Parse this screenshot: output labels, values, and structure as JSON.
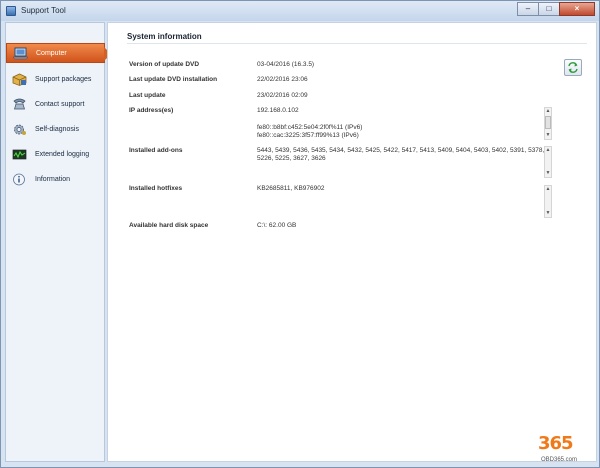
{
  "window": {
    "title": "Support Tool",
    "minimize": "–",
    "maximize": "□",
    "close": "×"
  },
  "sidebar": {
    "items": [
      {
        "label": "Computer",
        "icon": "laptop-icon",
        "active": true
      },
      {
        "label": "Support packages",
        "icon": "package-icon"
      },
      {
        "label": "Contact support",
        "icon": "phone-icon"
      },
      {
        "label": "Self-diagnosis",
        "icon": "gear-icon"
      },
      {
        "label": "Extended logging",
        "icon": "log-icon"
      },
      {
        "label": "Information",
        "icon": "info-icon"
      }
    ]
  },
  "main": {
    "heading": "System information",
    "rows": [
      {
        "label": "Version of update DVD",
        "value": "03-04/2016 (16.3.5)"
      },
      {
        "label": "Last update DVD installation",
        "value": "22/02/2016 23:06"
      },
      {
        "label": "Last update",
        "value": "23/02/2016 02:09"
      },
      {
        "label": "IP address(es)",
        "value": "192.168.0.102"
      },
      {
        "label": "",
        "value": "fe80::b8bf:c452:5e04:2f0f%11 (IPv6)"
      },
      {
        "label": "",
        "value": "fe80::cac:3225:3f57:ff99%13 (IPv6)"
      },
      {
        "label": "Installed add-ons",
        "value": "5443, 5439, 5436, 5435, 5434, 5432, 5425, 5422, 5417, 5413, 5409, 5404, 5403, 5402, 5391, 5378,"
      },
      {
        "label": "",
        "value": "5226, 5225, 3627, 3626"
      },
      {
        "label": "Installed hotfixes",
        "value": "KB2685811, KB976902"
      },
      {
        "label": "Available hard disk space",
        "value": "C:\\: 62.00 GB"
      }
    ]
  },
  "watermark": {
    "number": "365",
    "text": "OBD365.com"
  },
  "colors": {
    "accent": "#e06a2a",
    "sidebar_bg": "#eef3f9",
    "window_bg": "#d7e3f1"
  }
}
